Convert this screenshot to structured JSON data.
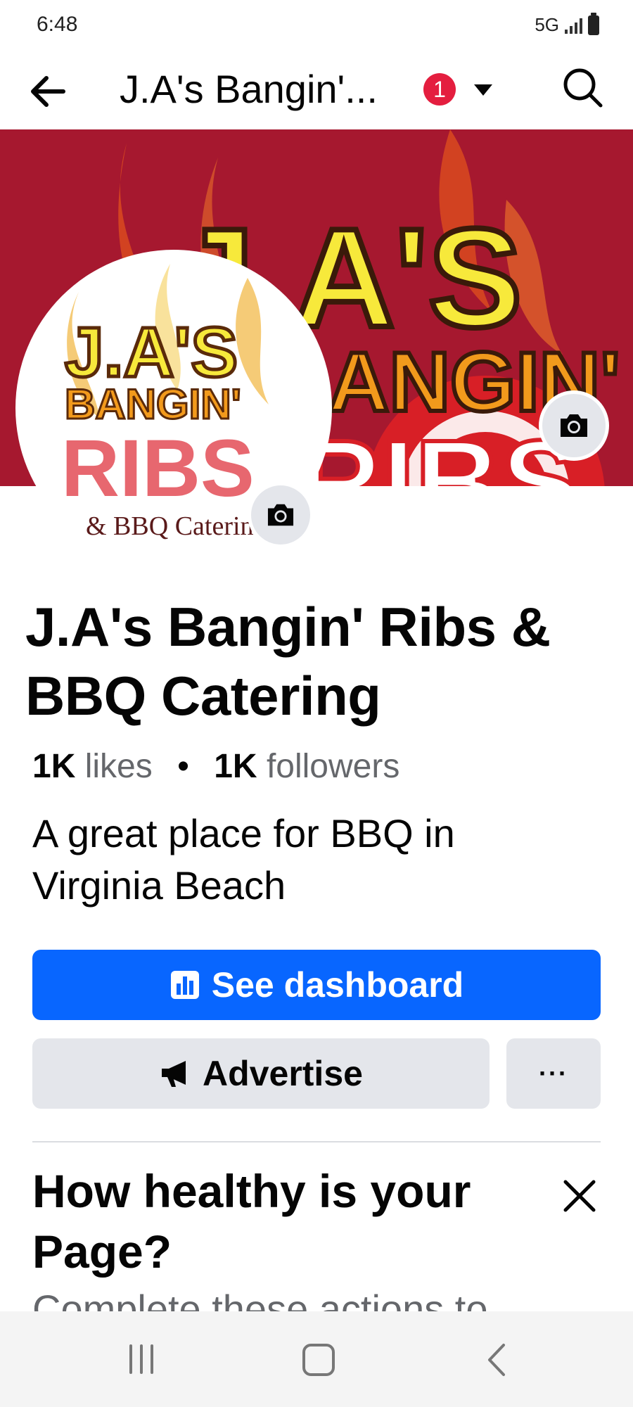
{
  "status_bar": {
    "time": "6:48",
    "network": "5G"
  },
  "header": {
    "title": "J.A's Bangin'...",
    "notification_count": "1",
    "icons": [
      "back-arrow-icon",
      "dropdown-caret-icon",
      "search-icon"
    ]
  },
  "cover": {
    "logo_line1": "J.A'S",
    "logo_line2": "BANGIN'",
    "logo_line3": "RIBS"
  },
  "profile": {
    "logo_line1": "J.A'S",
    "logo_line2": "BANGIN'",
    "logo_line3": "RIBS",
    "logo_line4": "& BBQ Caterin"
  },
  "page": {
    "name": "J.A's Bangin' Ribs & BBQ Catering",
    "likes_count": "1K",
    "likes_label": "likes",
    "followers_count": "1K",
    "followers_label": "followers",
    "separator": "•",
    "description": "A great place for BBQ in Virginia Beach"
  },
  "actions": {
    "dashboard_label": "See dashboard",
    "advertise_label": "Advertise",
    "more_label": "···"
  },
  "health_card": {
    "title": "How healthy is your Page?",
    "subtitle": "Complete these actions to"
  },
  "colors": {
    "primary_blue": "#0866ff",
    "cover_red": "#a6182f",
    "badge_red": "#e41e3f",
    "secondary_button": "#e4e6eb"
  }
}
